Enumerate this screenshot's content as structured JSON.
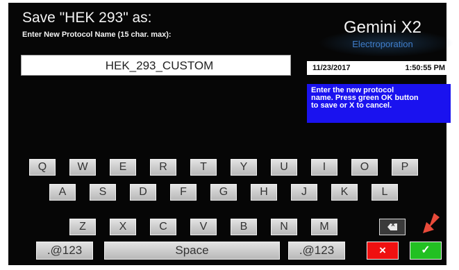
{
  "header": {
    "title": "Save \"HEK 293\" as:",
    "subtitle": "Enter New Protocol Name (15 char. max):"
  },
  "name_field": {
    "value": "HEK_293_CUSTOM"
  },
  "brand": {
    "name": "Gemini X2",
    "tagline": "Electroporation"
  },
  "datetime": {
    "date": "11/23/2017",
    "time": "1:50:55 PM"
  },
  "info": {
    "lines": [
      "Enter the new protocol",
      "name. Press green OK button",
      "to save or X to cancel."
    ],
    "box_color": "#1a12ef"
  },
  "keyboard": {
    "rows": [
      [
        "Q",
        "W",
        "E",
        "R",
        "T",
        "Y",
        "U",
        "I",
        "O",
        "P"
      ],
      [
        "A",
        "S",
        "D",
        "F",
        "G",
        "H",
        "J",
        "K",
        "L"
      ],
      [
        "Z",
        "X",
        "C",
        "V",
        "B",
        "N",
        "M"
      ]
    ],
    "backspace_icon": "backspace-icon",
    "sym_left": ".@123",
    "space": "Space",
    "sym_right": ".@123",
    "cancel": "×",
    "ok": "✓"
  },
  "colors": {
    "cancel": "#ef1010",
    "ok": "#22c022",
    "arrow": "#e84a3a"
  },
  "annotation_icon": "red-arrow-icon"
}
